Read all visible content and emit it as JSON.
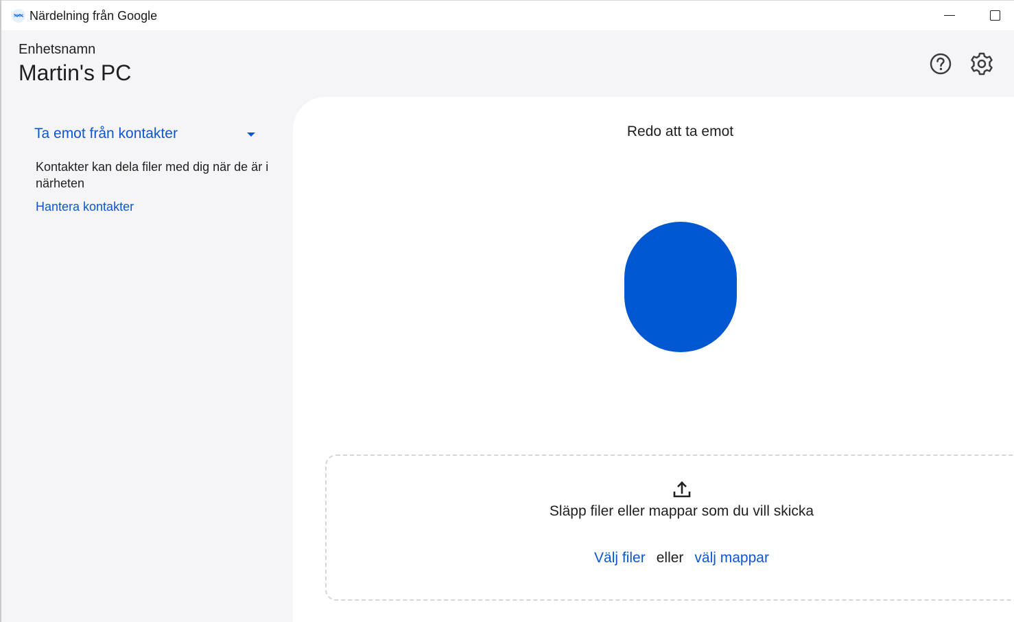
{
  "window": {
    "title": "Närdelning från Google",
    "icon": "nearby-share-icon"
  },
  "header": {
    "device_label": "Enhetsnamn",
    "device_name": "Martin's PC",
    "help_icon": "help-icon",
    "settings_icon": "gear-icon"
  },
  "sidebar": {
    "visibility_selected": "Ta emot från kontakter",
    "description": "Kontakter kan dela filer med dig när de är i närheten",
    "manage_link": "Hantera kontakter"
  },
  "main": {
    "status": "Redo att ta emot",
    "dropzone": {
      "icon": "upload-icon",
      "prompt": "Släpp filer eller mappar som du vill skicka",
      "choose_files": "Välj filer",
      "or": "eller",
      "choose_folders": "välj mappar"
    }
  },
  "colors": {
    "accent": "#0b57d0",
    "blob": "#0057d2",
    "background": "#f5f5f8",
    "panel": "#ffffff"
  }
}
